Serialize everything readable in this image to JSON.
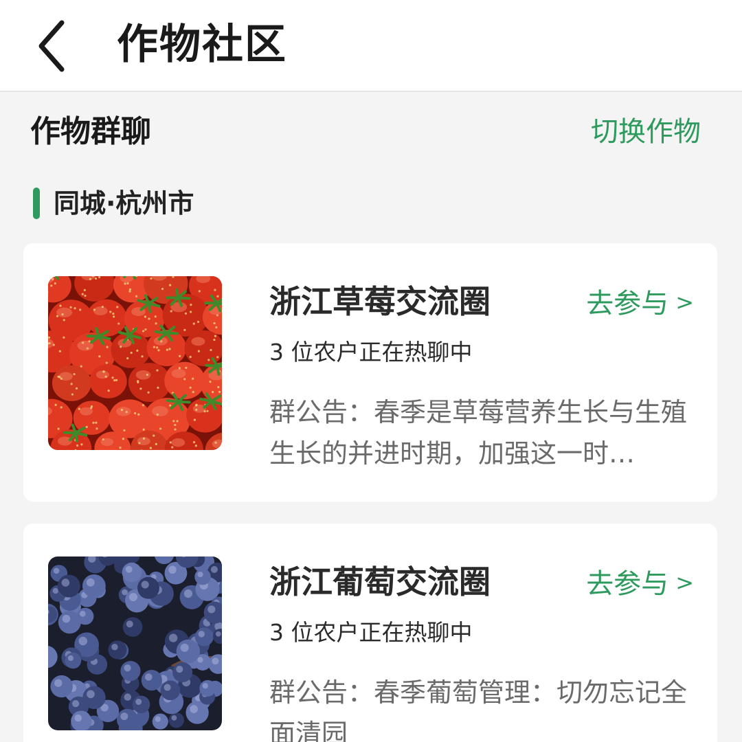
{
  "header": {
    "back_icon": "chevron-left-icon",
    "title": "作物社区"
  },
  "section": {
    "title": "作物群聊",
    "switch_label": "切换作物"
  },
  "city": {
    "label": "同城·杭州市",
    "accent_color": "#2e9a5e"
  },
  "groups": [
    {
      "name": "浙江草莓交流圈",
      "join_label": "去参与",
      "join_icon": "chevron-right-icon",
      "online_text": "3 位农户正在热聊中",
      "notice": "群公告：春季是草莓营养生长与生殖生长的并进时期，加强这一时…",
      "image_subject": "strawberries"
    },
    {
      "name": "浙江葡萄交流圈",
      "join_label": "去参与",
      "join_icon": "chevron-right-icon",
      "online_text": "3 位农户正在热聊中",
      "notice": "群公告：春季葡萄管理：切勿忘记全面清园",
      "image_subject": "grapes"
    }
  ],
  "colors": {
    "accent": "#2e9a5e",
    "text_primary": "#1a1a1a",
    "text_secondary": "#6a6a6a",
    "background": "#f4f4f4",
    "card": "#ffffff"
  }
}
